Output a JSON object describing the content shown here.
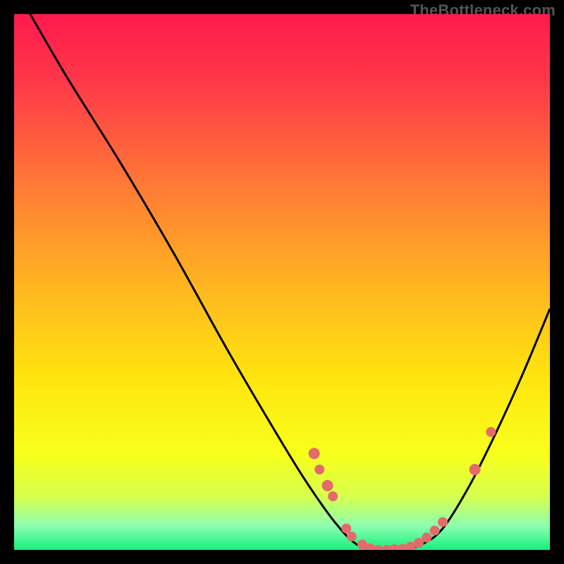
{
  "attribution": "TheBottleneck.com",
  "chart_data": {
    "type": "line",
    "title": "",
    "xlabel": "",
    "ylabel": "",
    "xlim": [
      0,
      100
    ],
    "ylim": [
      0,
      100
    ],
    "curve": [
      {
        "x": 3,
        "y": 100
      },
      {
        "x": 10,
        "y": 88
      },
      {
        "x": 20,
        "y": 72
      },
      {
        "x": 30,
        "y": 55
      },
      {
        "x": 40,
        "y": 37
      },
      {
        "x": 50,
        "y": 20
      },
      {
        "x": 55,
        "y": 12
      },
      {
        "x": 60,
        "y": 5
      },
      {
        "x": 64,
        "y": 1
      },
      {
        "x": 68,
        "y": 0
      },
      {
        "x": 72,
        "y": 0
      },
      {
        "x": 76,
        "y": 1
      },
      {
        "x": 80,
        "y": 4
      },
      {
        "x": 85,
        "y": 12
      },
      {
        "x": 90,
        "y": 22
      },
      {
        "x": 95,
        "y": 33
      },
      {
        "x": 100,
        "y": 45
      }
    ],
    "markers": [
      {
        "x": 56,
        "y": 18,
        "r": 8
      },
      {
        "x": 57,
        "y": 15,
        "r": 7
      },
      {
        "x": 58.5,
        "y": 12,
        "r": 8
      },
      {
        "x": 59.5,
        "y": 10,
        "r": 7
      },
      {
        "x": 62,
        "y": 4,
        "r": 7
      },
      {
        "x": 63,
        "y": 2.5,
        "r": 7
      },
      {
        "x": 65,
        "y": 1,
        "r": 7
      },
      {
        "x": 66.5,
        "y": 0.3,
        "r": 7
      },
      {
        "x": 68,
        "y": 0,
        "r": 7
      },
      {
        "x": 69.5,
        "y": 0,
        "r": 7
      },
      {
        "x": 71,
        "y": 0,
        "r": 8
      },
      {
        "x": 72.5,
        "y": 0.2,
        "r": 7
      },
      {
        "x": 74,
        "y": 0.6,
        "r": 7
      },
      {
        "x": 75.5,
        "y": 1.3,
        "r": 7
      },
      {
        "x": 77,
        "y": 2.3,
        "r": 7
      },
      {
        "x": 78.5,
        "y": 3.6,
        "r": 7
      },
      {
        "x": 80,
        "y": 5.2,
        "r": 7
      },
      {
        "x": 86,
        "y": 15,
        "r": 8
      },
      {
        "x": 89,
        "y": 22,
        "r": 7
      }
    ],
    "gradient_stops": [
      {
        "offset": 0,
        "color": "#ff1a4d"
      },
      {
        "offset": 0.13,
        "color": "#ff3949"
      },
      {
        "offset": 0.32,
        "color": "#ff7a36"
      },
      {
        "offset": 0.5,
        "color": "#ffb321"
      },
      {
        "offset": 0.68,
        "color": "#ffe50f"
      },
      {
        "offset": 0.82,
        "color": "#f8ff1a"
      },
      {
        "offset": 0.9,
        "color": "#d6ff4d"
      },
      {
        "offset": 0.955,
        "color": "#8dffb0"
      },
      {
        "offset": 1,
        "color": "#14f07d"
      }
    ],
    "marker_color": "#e36b6b",
    "curve_color": "#000000"
  }
}
